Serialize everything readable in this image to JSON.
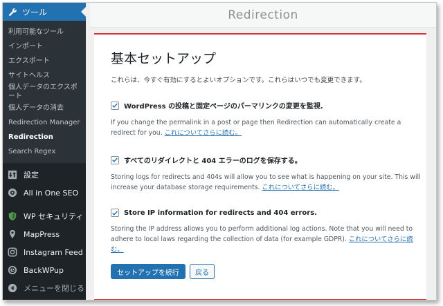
{
  "sidebar": {
    "active_menu": "ツール",
    "submenu": [
      "利用可能なツール",
      "インポート",
      "エクスポート",
      "サイトヘルス",
      "個人データのエクスポート",
      "個人データの消去",
      "Redirection Manager",
      "Redirection",
      "Search Regex"
    ],
    "menu": [
      {
        "label": "設定",
        "icon": "settings-icon"
      },
      {
        "label": "All in One SEO",
        "icon": "seo-icon"
      },
      {
        "label": "WP セキュリティ",
        "icon": "shield-icon"
      },
      {
        "label": "MapPress",
        "icon": "map-pin-icon"
      },
      {
        "label": "Instagram Feed",
        "icon": "instagram-icon"
      },
      {
        "label": "BackWPup",
        "icon": "backup-icon"
      }
    ],
    "collapse_label": "メニューを閉じる"
  },
  "header": {
    "title": "Redirection"
  },
  "main": {
    "heading": "基本セットアップ",
    "intro": "これらは、今すぐ有効にするとよいオプションです。これらはいつでも変更できます。",
    "options": [
      {
        "label": "WordPress の投稿と固定ページのパーマリンクの変更を監視.",
        "checked": true,
        "desc": "If you change the permalink in a post or page then Redirection can automatically create a redirect for you.",
        "link": "これについてさらに読む。"
      },
      {
        "label": "すべてのリダイレクトと 404 エラーのログを保存する。",
        "checked": true,
        "desc": "Storing logs for redirects and 404s will allow you to see what is happening on your site. This will increase your database storage requirements.",
        "link": "これについてさらに読む。"
      },
      {
        "label": "Store IP information for redirects and 404 errors.",
        "checked": true,
        "desc": "Storing the IP address allows you to perform additional log actions. Note that you will need to adhere to local laws regarding the collection of data (for example GDPR).",
        "link": "これについてさらに読む。"
      }
    ],
    "continue_label": "セットアップを続行",
    "back_label": "戻る"
  },
  "colors": {
    "accent": "#2271b1",
    "sidebar_bg": "#1d2327",
    "divider": "#d63638"
  }
}
